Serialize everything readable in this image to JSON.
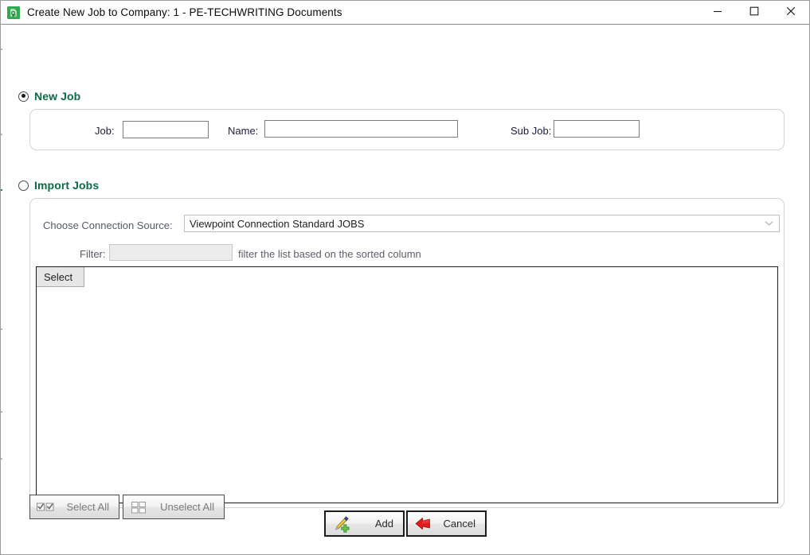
{
  "window": {
    "title": "Create New Job to Company: 1 - PE-TECHWRITING Documents",
    "app_icon": "green-document-lock-icon",
    "controls": {
      "minimize": "minimize-icon",
      "maximize": "maximize-icon",
      "close": "close-icon"
    }
  },
  "new_job": {
    "radio_label": "New Job",
    "selected": true,
    "job": {
      "label": "Job:",
      "value": "",
      "placeholder": ""
    },
    "name": {
      "label": "Name:",
      "value": "",
      "placeholder": ""
    },
    "sub_job": {
      "label": "Sub Job:",
      "value": "",
      "placeholder": ""
    }
  },
  "import_jobs": {
    "radio_label": "Import Jobs",
    "selected": false,
    "connection_source": {
      "label": "Choose Connection Source:",
      "value": "Viewpoint Connection Standard JOBS",
      "arrow_icon": "chevron-down-icon"
    },
    "filter": {
      "label": "Filter:",
      "value": "",
      "placeholder": "",
      "hint": "filter the list based on the sorted column"
    },
    "grid": {
      "columns": [
        "Select"
      ],
      "rows": []
    }
  },
  "footer": {
    "select_all": {
      "label": "Select All",
      "icon": "checked-boxes-icon",
      "enabled": false
    },
    "unselect_all": {
      "label": "Unselect All",
      "icon": "empty-boxes-icon",
      "enabled": false
    },
    "add": {
      "label": "Add",
      "icon": "pen-add-icon"
    },
    "cancel": {
      "label": "Cancel",
      "icon": "red-back-arrow-icon"
    }
  },
  "colors": {
    "section_header": "#0a6b45",
    "accent_green": "#3a9d3a",
    "accent_red": "#d81515",
    "grid_border": "#1a1a1a"
  }
}
